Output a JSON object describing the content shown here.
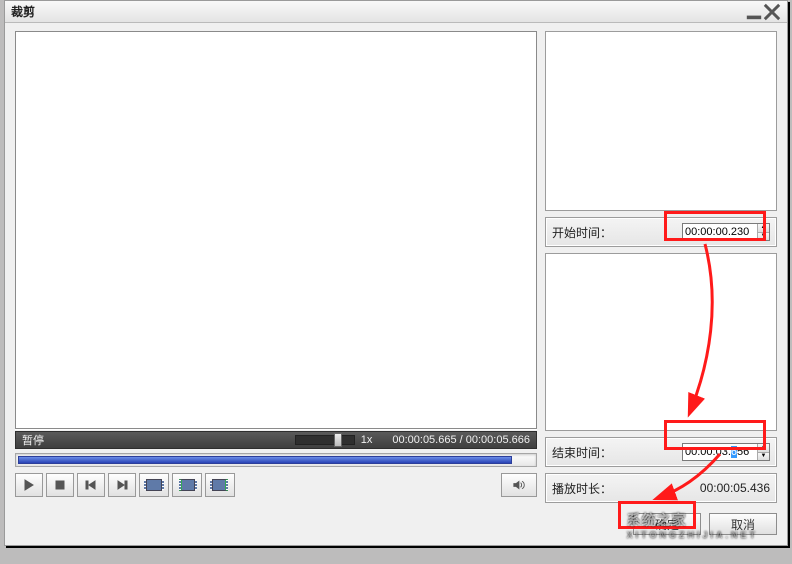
{
  "window": {
    "title": "裁剪"
  },
  "player": {
    "status_label": "暂停",
    "speed_label": "1x",
    "current_time": "00:00:05.665",
    "total_time": "00:00:05.666"
  },
  "form": {
    "start_label": "开始时间：",
    "start_value": "00:00:00.230",
    "end_label": "结束时间：",
    "end_value_prefix": "00:00:03.",
    "end_value_sel": "6",
    "end_value_suffix": "56",
    "duration_label": "播放时长：",
    "duration_value": "00:00:05.436"
  },
  "buttons": {
    "ok": "确定",
    "cancel": "取消"
  },
  "watermark": {
    "line1": "系统之家",
    "line2": "XITONGZHIJIA.NET"
  }
}
